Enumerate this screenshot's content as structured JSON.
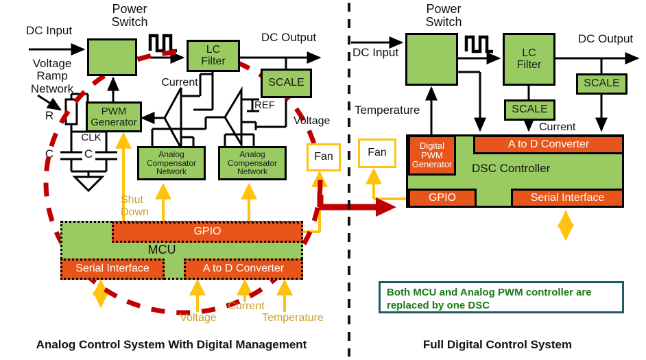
{
  "meta": {
    "colors": {
      "green_block": "#9ACB62",
      "orange_block": "#E8551A",
      "yellow_signal": "#FFC20E",
      "yellow_label_text": "#C8A02A",
      "red_dashed_circle": "#C00000",
      "note_border": "#1F5C66",
      "note_text": "#1A7A18",
      "line_black": "#000000"
    }
  },
  "left_panel": {
    "caption": "Analog Control System With Digital Management",
    "labels": {
      "dc_input": "DC Input",
      "power_switch": "Power\nSwitch",
      "voltage_ramp_network": "Voltage\nRamp\nNetwork",
      "r": "R",
      "c1": "C",
      "c2": "C",
      "clk": "CLK",
      "dc_output": "DC Output",
      "current": "Current",
      "ref": "REF",
      "voltage_side": "Voltage"
    },
    "blocks": {
      "power_switch": "",
      "lc_filter": "LC\nFilter",
      "scale": "SCALE",
      "pwm_generator": "PWM\nGenerator",
      "analog_comp_1": "Analog\nCompensator\nNetwork",
      "analog_comp_2": "Analog\nCompensator\nNetwork",
      "fan": "Fan",
      "mcu": "MCU",
      "gpio": "GPIO",
      "serial_interface": "Serial Interface",
      "adc": "A to D Converter"
    },
    "signal_labels": {
      "shut_down": "Shut\nDown",
      "voltage": "Voltage",
      "current": "Current",
      "temperature": "Temperature"
    }
  },
  "right_panel": {
    "caption": "Full Digital Control System",
    "labels": {
      "dc_input": "DC Input",
      "power_switch": "Power\nSwitch",
      "temperature": "Temperature",
      "dc_output": "DC Output",
      "current": "Current"
    },
    "blocks": {
      "lc_filter": "LC\nFilter",
      "scale_output": "SCALE",
      "scale_current": "SCALE",
      "fan": "Fan",
      "digital_pwm_generator": "Digital\nPWM\nGenerator",
      "adc": "A to D Converter",
      "dsc_controller": "DSC Controller",
      "gpio": "GPIO",
      "serial_interface": "Serial Interface"
    },
    "note": "Both MCU and Analog PWM controller are replaced by one DSC"
  }
}
